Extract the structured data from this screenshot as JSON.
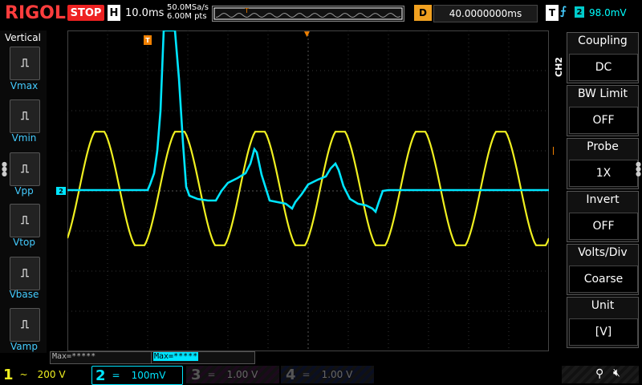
{
  "header": {
    "logo": "RIGOL",
    "run_state": "STOP",
    "timebase_label": "H",
    "timebase": "10.0ms",
    "sample_rate": "50.0MSa/s",
    "memory_depth": "6.00M pts",
    "delay_label": "D",
    "delay": "40.0000000ms",
    "trigger_label": "T",
    "trigger_channel": "2",
    "trigger_level": "98.0mV"
  },
  "measure_menu": {
    "title": "Vertical",
    "items": [
      {
        "label": "Vmax"
      },
      {
        "label": "Vmin"
      },
      {
        "label": "Vpp"
      },
      {
        "label": "Vtop"
      },
      {
        "label": "Vbase"
      },
      {
        "label": "Vamp"
      }
    ]
  },
  "channel_menu": {
    "channel_tag": "CH2",
    "items": [
      {
        "title": "Coupling",
        "value": "DC"
      },
      {
        "title": "BW Limit",
        "value": "OFF"
      },
      {
        "title": "Probe",
        "value": "1X"
      },
      {
        "title": "Invert",
        "value": "OFF"
      },
      {
        "title": "Volts/Div",
        "value": "Coarse"
      },
      {
        "title": "Unit",
        "value": "[V]"
      }
    ]
  },
  "measurements": {
    "m1": "Max=*****",
    "m2": "Max=*****"
  },
  "channels": [
    {
      "num": "1",
      "coupling": "~",
      "scale": "200 V",
      "color": "#f0f020"
    },
    {
      "num": "2",
      "coupling": "=",
      "scale": "100mV",
      "color": "#00e5ff"
    },
    {
      "num": "3",
      "coupling": "=",
      "scale": "1.00 V",
      "color": "#d040d0"
    },
    {
      "num": "4",
      "coupling": "=",
      "scale": "1.00 V",
      "color": "#3070ff"
    }
  ],
  "markers": {
    "ch2_ground": "2",
    "trigger_pos": "T",
    "trigger_level": "T"
  },
  "colors": {
    "ch1": "#f0f020",
    "ch2": "#00e5ff",
    "accent": "#ff8c00"
  }
}
